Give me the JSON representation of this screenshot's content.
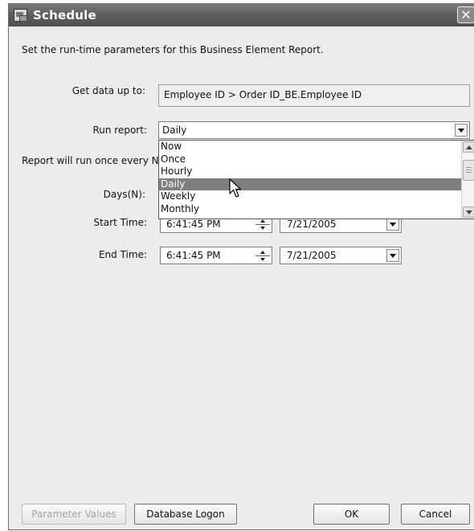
{
  "window": {
    "title": "Schedule",
    "icon": "schedule-window-icon",
    "close_glyph": "✕"
  },
  "intro": "Set the run-time parameters for this Business Element Report.",
  "get_data": {
    "label": "Get data up to:",
    "value": "Employee ID > Order ID_BE.Employee ID"
  },
  "run_report": {
    "label": "Run report:",
    "value": "Daily",
    "options": [
      "Now",
      "Once",
      "Hourly",
      "Daily",
      "Weekly",
      "Monthly"
    ],
    "selected_index": 3
  },
  "every_label": "Report will run once every N",
  "days_label": "Days(N):",
  "start": {
    "label": "Start Time:",
    "time": "6:41:45 PM",
    "date": "7/21/2005"
  },
  "end": {
    "label": "End Time:",
    "time": "6:41:45 PM",
    "date": "7/21/2005"
  },
  "buttons": {
    "param": "Parameter Values",
    "logon": "Database Logon",
    "ok": "OK",
    "cancel": "Cancel"
  },
  "colors": {
    "titlebar": "#5f5f5f",
    "selection": "#7f7f7f",
    "dialog_bg": "#ececec"
  }
}
